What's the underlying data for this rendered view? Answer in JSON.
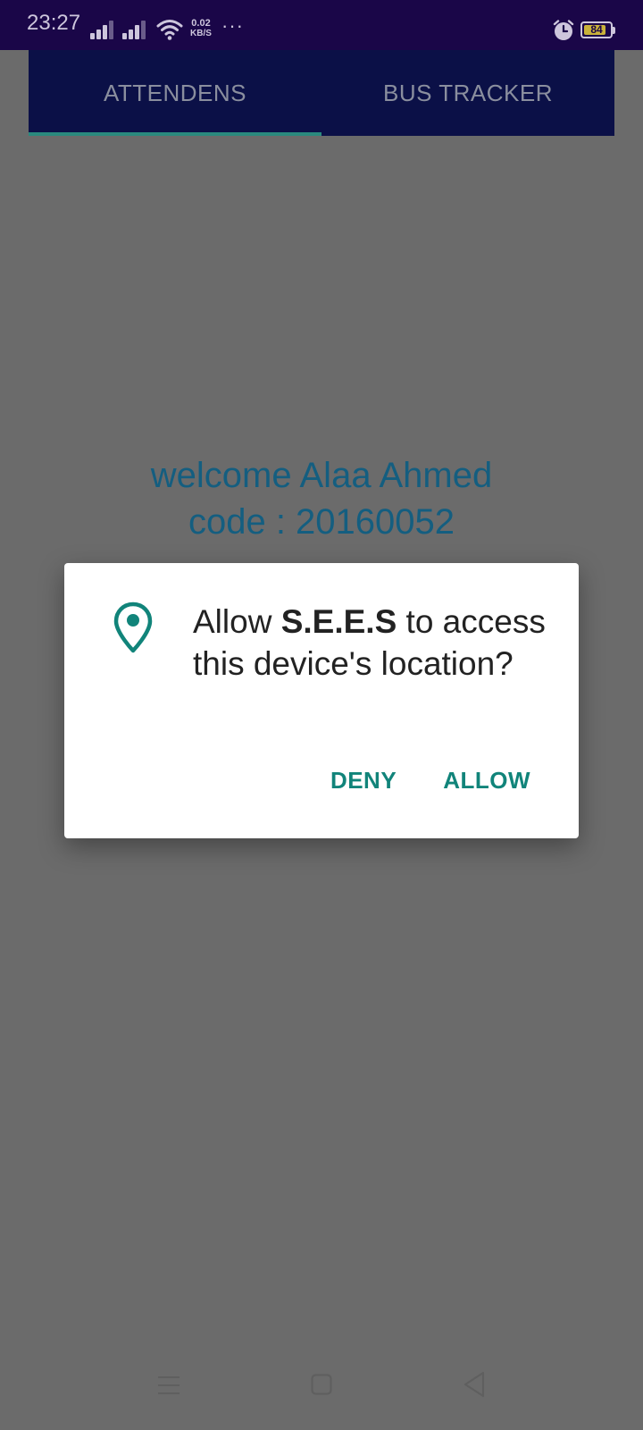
{
  "status_bar": {
    "time": "23:27",
    "net_speed_value": "0.02",
    "net_speed_unit": "KB/S",
    "more": "···",
    "battery_level": "84",
    "battery_fraction": 0.84
  },
  "tabs": [
    {
      "label": "ATTENDENS",
      "selected": true
    },
    {
      "label": "BUS TRACKER",
      "selected": false
    }
  ],
  "main": {
    "welcome_line": "welcome Alaa Ahmed",
    "code_line": "code : 20160052"
  },
  "dialog": {
    "icon": "location-pin-icon",
    "message_prefix": "Allow ",
    "app_name": "S.E.E.S",
    "message_suffix": " to access this device's location?",
    "deny_label": "DENY",
    "allow_label": "ALLOW"
  },
  "colors": {
    "status_bar": "#1a0648",
    "tab_bar": "#0b1047",
    "tab_indicator": "#2a8a7e",
    "scrim_background": "#6b6b6b",
    "welcome_text": "#145e80",
    "accent": "#11847a"
  }
}
